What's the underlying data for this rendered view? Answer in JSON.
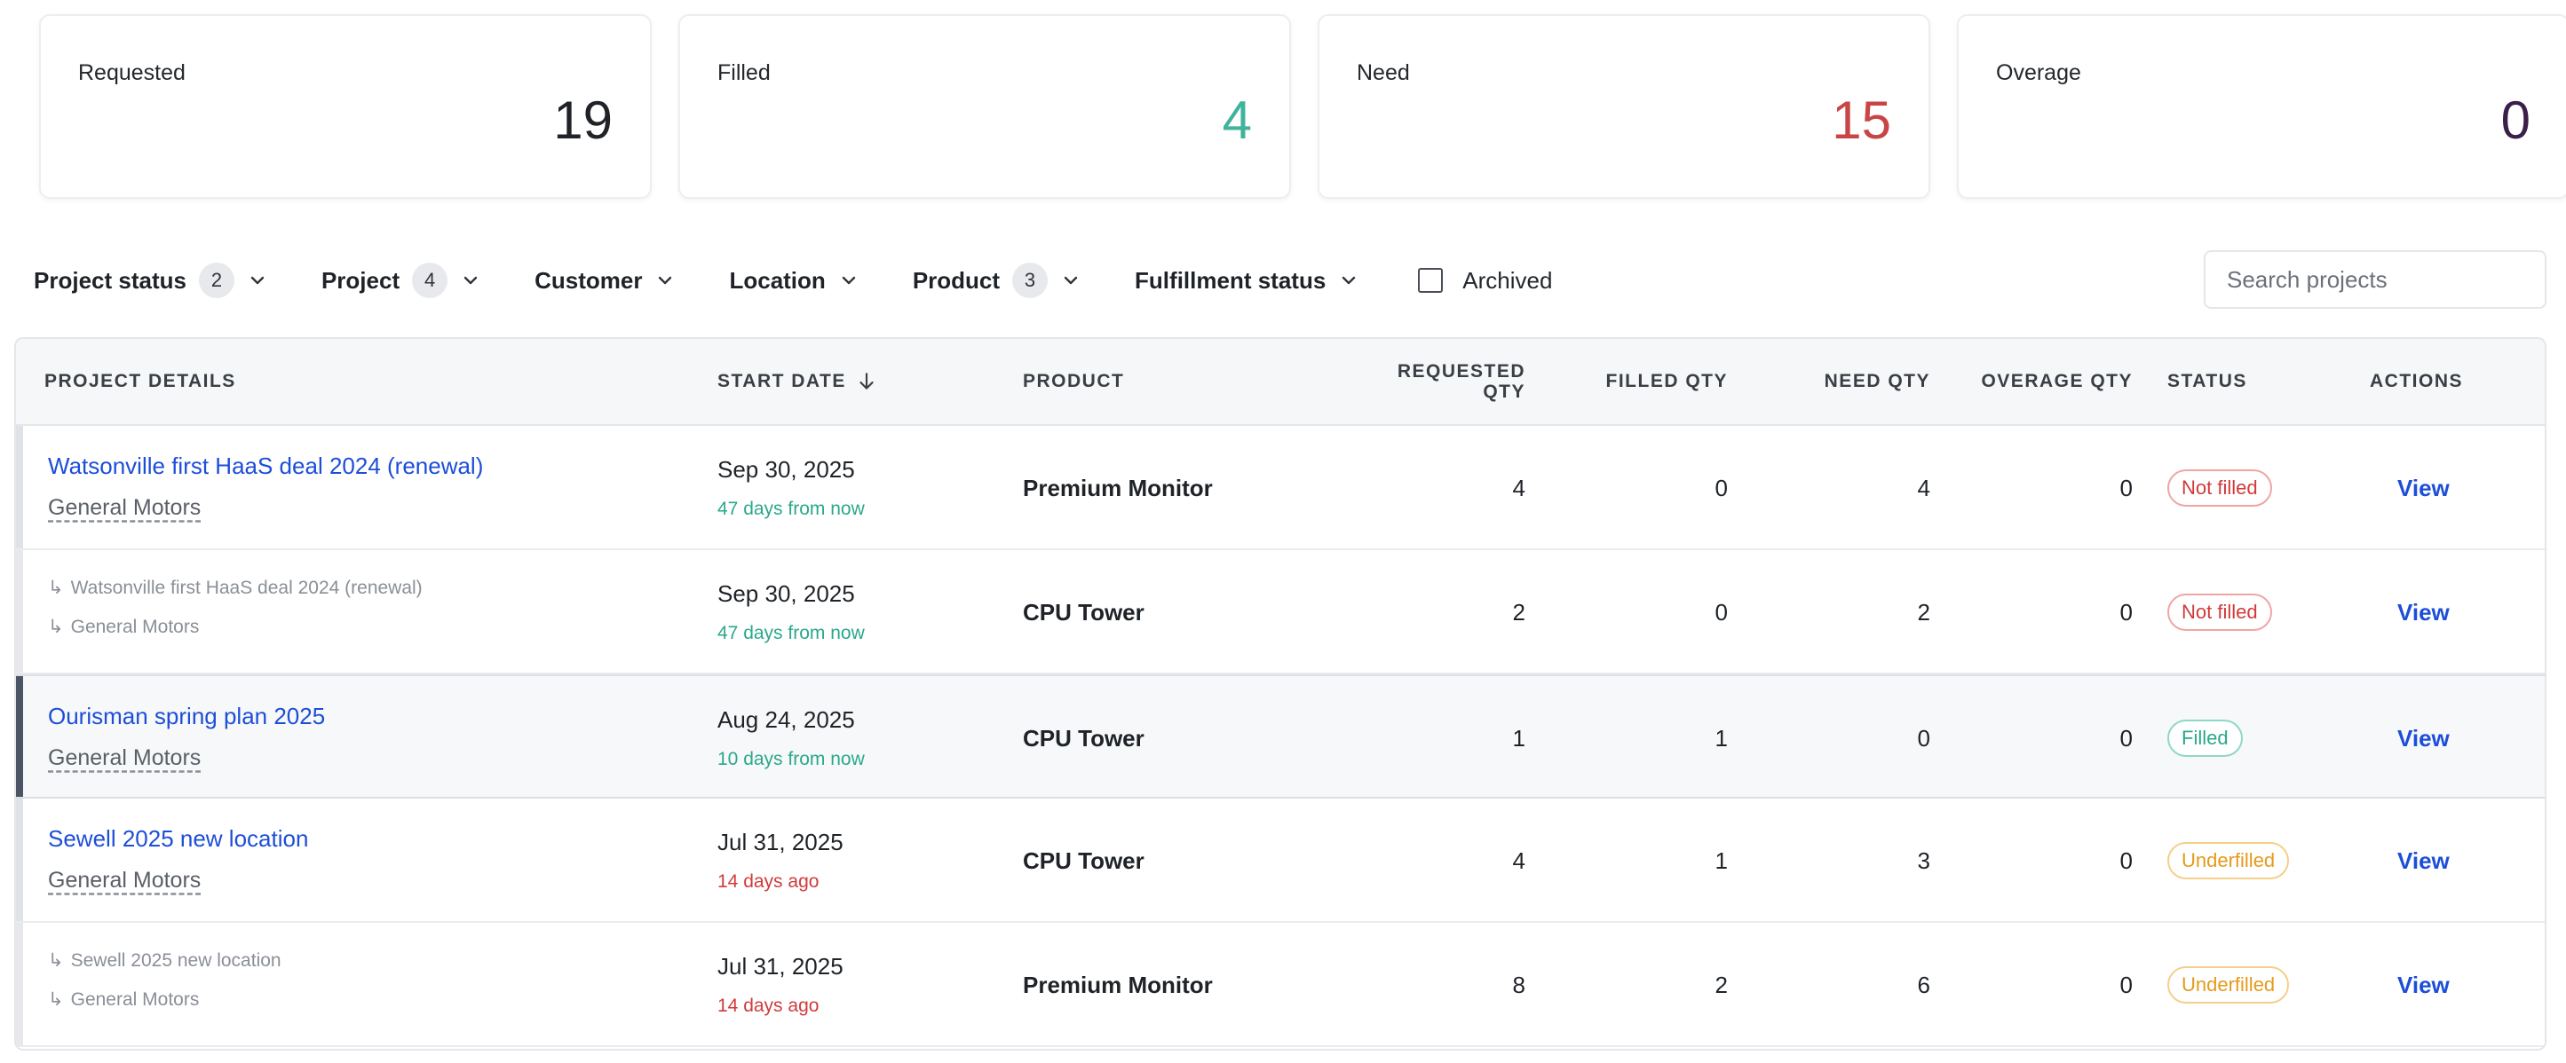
{
  "stats": [
    {
      "label": "Requested",
      "value": "19",
      "color": "#1f2328"
    },
    {
      "label": "Filled",
      "value": "4",
      "color": "#3fb39b"
    },
    {
      "label": "Need",
      "value": "15",
      "color": "#c84545"
    },
    {
      "label": "Overage",
      "value": "0",
      "color": "#3b1f4a"
    }
  ],
  "filters": {
    "project_status": {
      "label": "Project status",
      "count": "2"
    },
    "project": {
      "label": "Project",
      "count": "4"
    },
    "customer": {
      "label": "Customer"
    },
    "location": {
      "label": "Location"
    },
    "product": {
      "label": "Product",
      "count": "3"
    },
    "fulfillment_status": {
      "label": "Fulfillment status"
    },
    "archived": {
      "label": "Archived",
      "checked": false
    }
  },
  "search": {
    "placeholder": "Search projects"
  },
  "table": {
    "headers": {
      "project_details": "PROJECT DETAILS",
      "start_date": "START DATE",
      "product": "PRODUCT",
      "requested_qty_1": "REQUESTED",
      "requested_qty_2": "QTY",
      "filled_qty": "FILLED QTY",
      "need_qty": "NEED QTY",
      "overage_qty": "OVERAGE QTY",
      "status": "STATUS",
      "actions": "ACTIONS"
    },
    "rows": [
      {
        "project": "Watsonville first HaaS deal 2024 (renewal)",
        "customer": "General Motors",
        "date": "Sep 30, 2025",
        "relative": "47 days from now",
        "product": "Premium Monitor",
        "requested": "4",
        "filled": "0",
        "need": "4",
        "overage": "0",
        "status": "Not filled",
        "action": "View"
      },
      {
        "project": "Watsonville first HaaS deal 2024 (renewal)",
        "customer": "General Motors",
        "date": "Sep 30, 2025",
        "relative": "47 days from now",
        "product": "CPU Tower",
        "requested": "2",
        "filled": "0",
        "need": "2",
        "overage": "0",
        "status": "Not filled",
        "action": "View"
      },
      {
        "project": "Ourisman spring plan 2025",
        "customer": "General Motors",
        "date": "Aug 24, 2025",
        "relative": "10 days from now",
        "product": "CPU Tower",
        "requested": "1",
        "filled": "1",
        "need": "0",
        "overage": "0",
        "status": "Filled",
        "action": "View"
      },
      {
        "project": "Sewell 2025 new location",
        "customer": "General Motors",
        "date": "Jul 31, 2025",
        "relative": "14 days ago",
        "product": "CPU Tower",
        "requested": "4",
        "filled": "1",
        "need": "3",
        "overage": "0",
        "status": "Underfilled",
        "action": "View"
      },
      {
        "project": "Sewell 2025 new location",
        "customer": "General Motors",
        "date": "Jul 31, 2025",
        "relative": "14 days ago",
        "product": "Premium Monitor",
        "requested": "8",
        "filled": "2",
        "need": "6",
        "overage": "0",
        "status": "Underfilled",
        "action": "View"
      }
    ]
  }
}
